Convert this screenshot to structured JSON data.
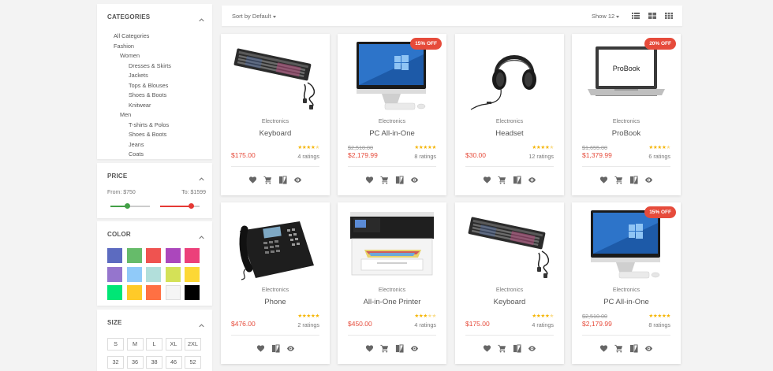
{
  "sidebar": {
    "categories": {
      "title": "CATEGORIES",
      "items": [
        {
          "label": "All Categories",
          "level": 0
        },
        {
          "label": "Fashion",
          "level": 0
        },
        {
          "label": "Women",
          "level": 1
        },
        {
          "label": "Dresses & Skirts",
          "level": 2
        },
        {
          "label": "Jackets",
          "level": 2
        },
        {
          "label": "Tops & Blouses",
          "level": 2
        },
        {
          "label": "Shoes & Boots",
          "level": 2
        },
        {
          "label": "Knitwear",
          "level": 2
        },
        {
          "label": "Men",
          "level": 1
        },
        {
          "label": "T-shirts & Polos",
          "level": 2
        },
        {
          "label": "Shoes & Boots",
          "level": 2
        },
        {
          "label": "Jeans",
          "level": 2
        },
        {
          "label": "Coats",
          "level": 2
        }
      ]
    },
    "price": {
      "title": "PRICE",
      "from_label": "From: $750",
      "to_label": "To: $1599",
      "from_value": 750,
      "to_value": 1599,
      "from_color": "#43a047",
      "to_color": "#e53935"
    },
    "color": {
      "title": "COLOR",
      "swatches": [
        "#5c6bc0",
        "#66bb6a",
        "#ef5350",
        "#ab47bc",
        "#ec407a",
        "#9575cd",
        "#90caf9",
        "#b2dfdb",
        "#d4e157",
        "#fdd835",
        "#00e676",
        "#ffca28",
        "#ff7043",
        "#f5f5f5",
        "#000000"
      ]
    },
    "size": {
      "title": "SIZE",
      "options": [
        "S",
        "M",
        "L",
        "XL",
        "2XL",
        "32",
        "36",
        "38",
        "46",
        "52"
      ]
    }
  },
  "toolbar": {
    "sort_label": "Sort by Default",
    "show_label": "Show 12",
    "views": [
      "list-view-icon",
      "grid-view-icon",
      "compact-grid-view-icon"
    ]
  },
  "products": [
    {
      "image": "keyboard",
      "category": "Electronics",
      "name": "Keyboard",
      "old_price": "",
      "price": "$175.00",
      "rating": 4.5,
      "stars": "★★★★★",
      "ratings": "4 ratings",
      "badge": "",
      "actions": [
        "heart-icon",
        "cart-icon",
        "compare-icon",
        "eye-icon"
      ]
    },
    {
      "image": "pc",
      "category": "Electronics",
      "name": "PC All-in-One",
      "old_price": "$2,510.00",
      "price": "$2,179.99",
      "rating": 5,
      "stars": "★★★★★",
      "ratings": "8 ratings",
      "badge": "15% OFF",
      "actions": [
        "heart-icon",
        "cart-icon",
        "compare-icon",
        "eye-icon"
      ]
    },
    {
      "image": "headset",
      "category": "Electronics",
      "name": "Headset",
      "old_price": "",
      "price": "$30.00",
      "rating": 4.5,
      "stars": "★★★★★",
      "ratings": "12 ratings",
      "badge": "",
      "actions": [
        "heart-icon",
        "cart-icon",
        "compare-icon",
        "eye-icon"
      ]
    },
    {
      "image": "laptop",
      "category": "Electronics",
      "name": "ProBook",
      "old_price": "$1,655.00",
      "price": "$1,379.99",
      "rating": 4.5,
      "stars": "★★★★★",
      "ratings": "6 ratings",
      "badge": "20% OFF",
      "screen_text": "ProBook",
      "actions": [
        "heart-icon",
        "cart-icon",
        "compare-icon",
        "eye-icon"
      ]
    },
    {
      "image": "phone",
      "category": "Electronics",
      "name": "Phone",
      "old_price": "",
      "price": "$476.00",
      "rating": 5,
      "stars": "★★★★★",
      "ratings": "2 ratings",
      "badge": "",
      "actions": [
        "heart-icon",
        "compare-icon",
        "eye-icon"
      ]
    },
    {
      "image": "printer",
      "category": "Electronics",
      "name": "All-in-One Printer",
      "old_price": "",
      "price": "$450.00",
      "rating": 3.5,
      "stars": "★★★★★",
      "ratings": "4 ratings",
      "badge": "",
      "actions": [
        "heart-icon",
        "cart-icon",
        "compare-icon",
        "eye-icon"
      ]
    },
    {
      "image": "keyboard",
      "category": "Electronics",
      "name": "Keyboard",
      "old_price": "",
      "price": "$175.00",
      "rating": 4.5,
      "stars": "★★★★★",
      "ratings": "4 ratings",
      "badge": "",
      "actions": [
        "heart-icon",
        "cart-icon",
        "compare-icon",
        "eye-icon"
      ]
    },
    {
      "image": "pc",
      "category": "Electronics",
      "name": "PC All-in-One",
      "old_price": "$2,510.00",
      "price": "$2,179.99",
      "rating": 5,
      "stars": "★★★★★",
      "ratings": "8 ratings",
      "badge": "15% OFF",
      "actions": [
        "heart-icon",
        "cart-icon",
        "compare-icon",
        "eye-icon"
      ]
    }
  ]
}
